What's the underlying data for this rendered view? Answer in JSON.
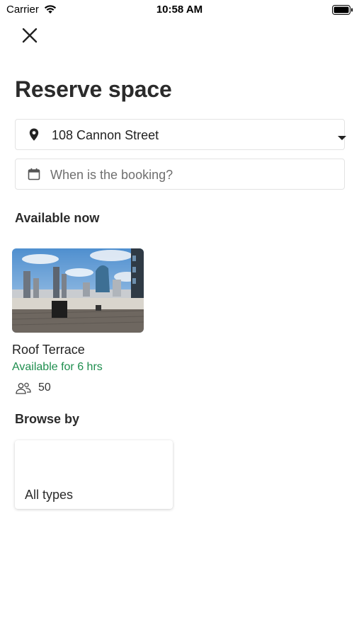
{
  "status_bar": {
    "carrier": "Carrier",
    "time": "10:58 AM"
  },
  "page": {
    "title": "Reserve space"
  },
  "location": {
    "value": "108 Cannon Street"
  },
  "booking": {
    "placeholder": "When is the booking?"
  },
  "available_now": {
    "heading": "Available now",
    "spaces": [
      {
        "name": "Roof Terrace",
        "availability": "Available for 6 hrs",
        "capacity": "50"
      }
    ]
  },
  "browse_by": {
    "heading": "Browse by",
    "types": [
      {
        "label": "All types"
      }
    ]
  },
  "colors": {
    "available_green": "#1e8e4e",
    "text_dark": "#2b2b2b"
  }
}
